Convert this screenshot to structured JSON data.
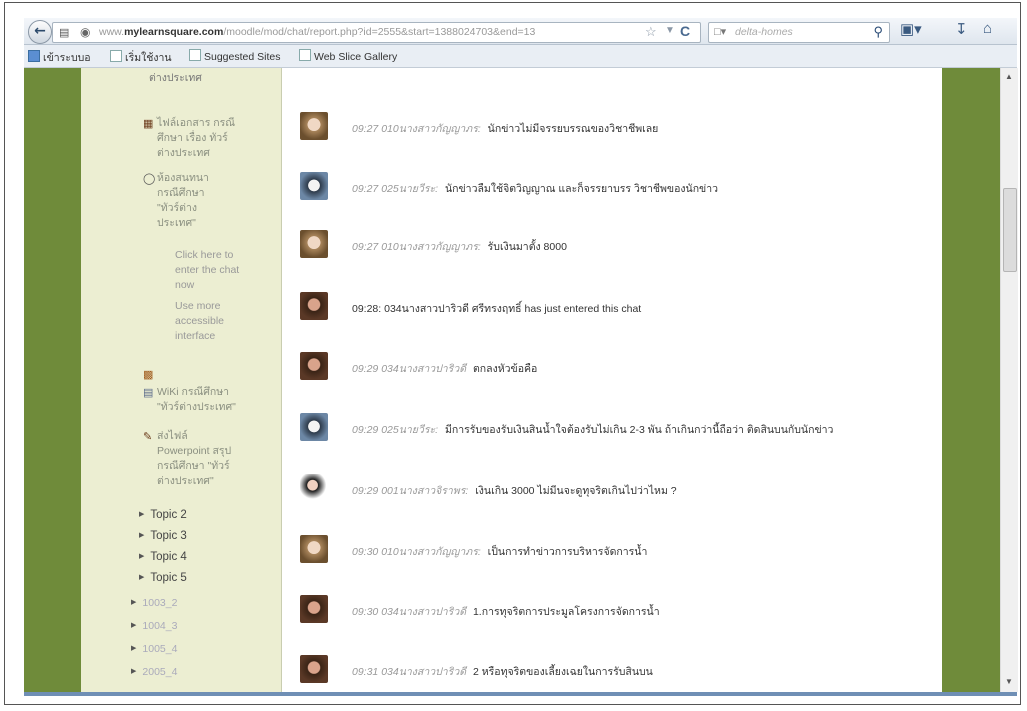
{
  "browser": {
    "url_prefix": "www.",
    "url_domain": "mylearnsquare.com",
    "url_path": "/moodle/mod/chat/report.php?id=2555&start=1388024703&end=13",
    "search_placeholder": "delta-homes"
  },
  "bookmarks": [
    {
      "label": "เข้าระบบอ"
    },
    {
      "label": "เริ่มใช้งาน"
    },
    {
      "label": "Suggested Sites"
    },
    {
      "label": "Web Slice Gallery"
    }
  ],
  "sidebar": {
    "line_top": "ต่างประเทศ",
    "item1_lines": [
      "ไฟล์เอกสาร กรณี",
      "ศึกษา เรื่อง ทัวร์",
      "ต่างประเทศ"
    ],
    "item2_lines": [
      "ห้องสนทนา",
      "กรณีศึกษา",
      "\"ทัวร์ต่าง",
      "ประเทศ\""
    ],
    "chat_link_lines": [
      "Click here to",
      "enter the chat",
      "now"
    ],
    "access_lines": [
      "Use more",
      "accessible",
      "interface"
    ],
    "wiki_lines": [
      "WiKi กรณีศึกษา",
      "\"ทัวร์ต่างประเทศ\""
    ],
    "ppt_lines": [
      "ส่งไฟล์",
      "Powerpoint สรุป",
      "กรณีศึกษา \"ทัวร์",
      "ต่างประเทศ\""
    ],
    "topics": [
      "Topic 2",
      "Topic 3",
      "Topic 4",
      "Topic 5"
    ],
    "subs": [
      "1003_2",
      "1004_3",
      "1005_4",
      "2005_4"
    ]
  },
  "chat": [
    {
      "time": "09:27",
      "author": "010นางสาวกัญญาภร:",
      "text": "นักข่าวไม่มีจรรยบรรณของวิชาชีพเลย"
    },
    {
      "time": "09:27",
      "author": "025นายวีระ:",
      "text": "นักข่าวลืมใช้จิตวิญญาณ และก็จรรยาบรร วิชาชีพของนักข่าว"
    },
    {
      "time": "09:27",
      "author": "010นางสาวกัญญาภร:",
      "text": "รับเงินมาตั้ง 8000"
    },
    {
      "time": "09:28:",
      "author": "",
      "text": "034นางสาวปาริวดี ศรีทรงฤทธิ์ has just entered this chat"
    },
    {
      "time": "09:29",
      "author": "034นางสาวปาริวดี",
      "text": "ตกลงหัวข้อคือ"
    },
    {
      "time": "09:29",
      "author": "025นายวีระ:",
      "text": "มีการรับของรับเงินสินน้ำใจต้องรับไม่เกิน 2-3 พัน ถ้าเกินกว่านี้ถือว่า ติดสินบนกับนักข่าว"
    },
    {
      "time": "09:29",
      "author": "001นางสาวจิราพร:",
      "text": "เงินเกิน 3000 ไม่มีนจะดูทุจริตเกินไปว่าไหม ?"
    },
    {
      "time": "09:30",
      "author": "010นางสาวกัญญาภร:",
      "text": "เป็นการทำข่าวการบริหารจัดการน้ำ"
    },
    {
      "time": "09:30",
      "author": "034นางสาวปาริวดี",
      "text": "1.การทุจริตการประมูลโครงการจัดการน้ำ"
    },
    {
      "time": "09:31",
      "author": "034นางสาวปาริวดี",
      "text": "2 หรือทุจริตของเลี้ยงเฉยในการรับสินบน"
    }
  ]
}
